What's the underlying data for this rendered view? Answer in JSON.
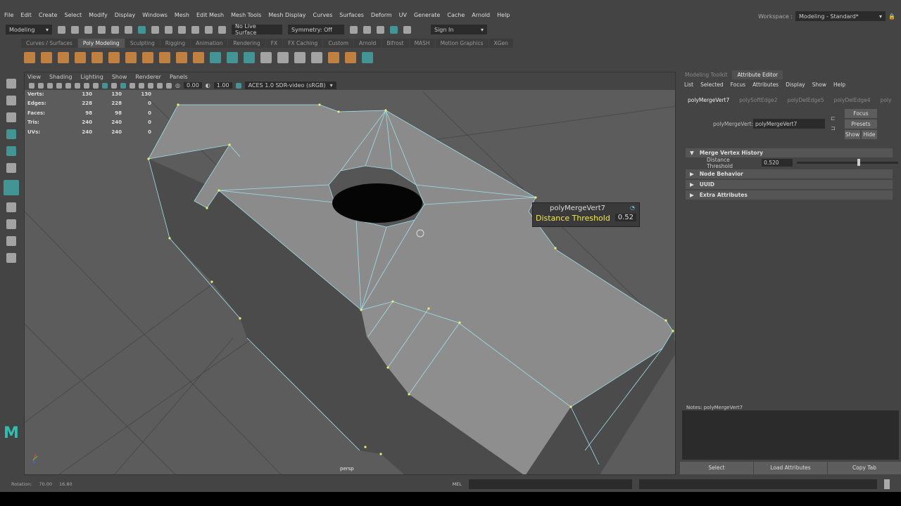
{
  "menubar": [
    "File",
    "Edit",
    "Create",
    "Select",
    "Modify",
    "Display",
    "Windows",
    "Mesh",
    "Edit Mesh",
    "Mesh Tools",
    "Mesh Display",
    "Curves",
    "Surfaces",
    "Deform",
    "UV",
    "Generate",
    "Cache",
    "Arnold",
    "Help"
  ],
  "workspace": {
    "label": "Workspace :",
    "value": "Modeling - Standard*"
  },
  "status": {
    "menuset": "Modeling",
    "live_surface": "No Live Surface",
    "symmetry": "Symmetry: Off",
    "sign_in": "Sign In"
  },
  "shelf_tabs": [
    "Curves / Surfaces",
    "Poly Modeling",
    "Sculpting",
    "Rigging",
    "Animation",
    "Rendering",
    "FX",
    "FX Caching",
    "Custom",
    "Arnold",
    "Bifrost",
    "MASH",
    "Motion Graphics",
    "XGen"
  ],
  "viewport": {
    "menu": [
      "View",
      "Shading",
      "Lighting",
      "Show",
      "Renderer",
      "Panels"
    ],
    "exposure": "0.00",
    "gamma": "1.00",
    "color_space": "ACES 1.0 SDR-video (sRGB)",
    "hud": [
      {
        "label": "Verts:",
        "a": "130",
        "b": "130",
        "c": "130"
      },
      {
        "label": "Edges:",
        "a": "228",
        "b": "228",
        "c": "0"
      },
      {
        "label": "Faces:",
        "a": "98",
        "b": "98",
        "c": "0"
      },
      {
        "label": "Tris:",
        "a": "240",
        "b": "240",
        "c": "0"
      },
      {
        "label": "UVs:",
        "a": "240",
        "b": "240",
        "c": "0"
      }
    ],
    "camera": "persp",
    "tooltip": {
      "title": "polyMergeVert7",
      "label": "Distance Threshold",
      "value": "0.52"
    }
  },
  "panel": {
    "tabs": [
      "Modeling Toolkit",
      "Attribute Editor"
    ],
    "menu": [
      "List",
      "Selected",
      "Focus",
      "Attributes",
      "Display",
      "Show",
      "Help"
    ],
    "node_tabs": [
      "polyMergeVert7",
      "polySoftEdge2",
      "polyDelEdge5",
      "polyDelEdge4",
      "poly"
    ],
    "node_label": "polyMergeVert:",
    "node_value": "polyMergeVert7",
    "focus": "Focus",
    "presets": "Presets",
    "show": "Show",
    "hide": "Hide",
    "sections": [
      "Merge Vertex History",
      "Node Behavior",
      "UUID",
      "Extra Attributes"
    ],
    "threshold_label": "Distance Threshold",
    "threshold_value": "0.520",
    "threshold_fraction": 0.6,
    "notes": "Notes:  polyMergeVert7",
    "buttons": [
      "Select",
      "Load Attributes",
      "Copy Tab"
    ]
  },
  "bottom": {
    "label": "Rotation:",
    "x": "70.00",
    "y": "16.80",
    "mel": "MEL"
  }
}
